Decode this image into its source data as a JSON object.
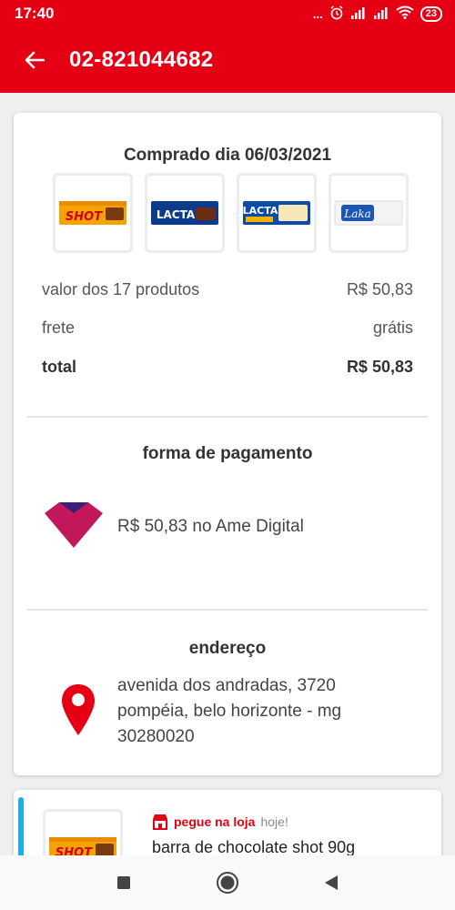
{
  "status_bar": {
    "time": "17:40",
    "dots": "...",
    "battery": "23",
    "icons": [
      "alarm-icon",
      "signal-icon",
      "signal-icon",
      "wifi-icon",
      "battery-icon"
    ]
  },
  "app_bar": {
    "title": "02-821044682",
    "back_icon": "arrow-left-icon"
  },
  "order": {
    "purchase_date": "Comprado dia 06/03/2021",
    "products": [
      {
        "brand": "SHOT",
        "image": "shot-chocolate-bar"
      },
      {
        "brand": "LACTA",
        "image": "lacta-chocolate-bar"
      },
      {
        "brand": "LACTA",
        "image": "lacta-white-chocolate-bar"
      },
      {
        "brand": "Laka",
        "image": "laka-chocolate-bar"
      }
    ],
    "summary": {
      "items_label": "valor dos 17 produtos",
      "items_value": "R$ 50,83",
      "shipping_label": "frete",
      "shipping_value": "grátis",
      "total_label": "total",
      "total_value": "R$ 50,83"
    }
  },
  "payment": {
    "title": "forma de pagamento",
    "text": "R$ 50,83 no Ame Digital",
    "icon": "ame-digital-logo",
    "colors": {
      "primary": "#c2185b",
      "dark": "#3a1f7a"
    }
  },
  "address": {
    "title": "endereço",
    "line1": "avenida dos andradas, 3720",
    "line2": "pompéia, belo horizonte - mg",
    "line3": "30280020",
    "icon": "map-pin-icon"
  },
  "item": {
    "pickup_strong": "pegue na loja",
    "pickup_soft": "hoje!",
    "pickup_icon": "store-icon",
    "name": "barra de chocolate shot 90g",
    "brand": "SHOT"
  },
  "nav": {
    "icons": [
      "square-icon",
      "circle-icon",
      "triangle-back-icon"
    ]
  },
  "colors": {
    "brand": "#e60014",
    "accent": "#1ab0e4"
  }
}
